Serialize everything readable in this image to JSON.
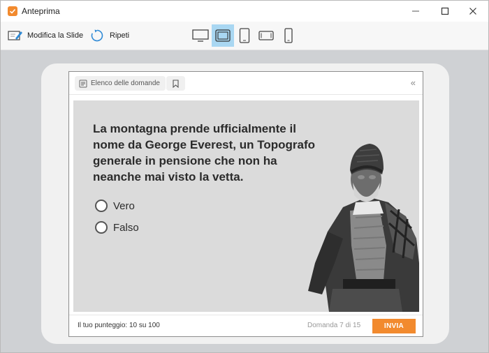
{
  "window": {
    "title": "Anteprima"
  },
  "toolbar": {
    "edit_label": "Modifica la Slide",
    "replay_label": "Ripeti",
    "devices": [
      "desktop",
      "desktop-framed",
      "tablet-portrait",
      "tablet-landscape",
      "phone-portrait"
    ],
    "active_device": "desktop-framed"
  },
  "player": {
    "question_list_label": "Elenco delle domande",
    "collapse_glyph": "«",
    "question": "La montagna prende ufficialmente il nome da George Everest, un Topografo generale in pensione che non ha neanche mai visto la vetta.",
    "options": [
      {
        "label": "Vero"
      },
      {
        "label": "Falso"
      }
    ],
    "score_text": "Il tuo punteggio: 10 su 100",
    "counter_text": "Domanda 7 di 15",
    "submit_label": "INVIA"
  },
  "colors": {
    "accent": "#f28a2e",
    "active_device_bg": "#a9d7f2",
    "slide_bg": "#dbdbdb"
  }
}
